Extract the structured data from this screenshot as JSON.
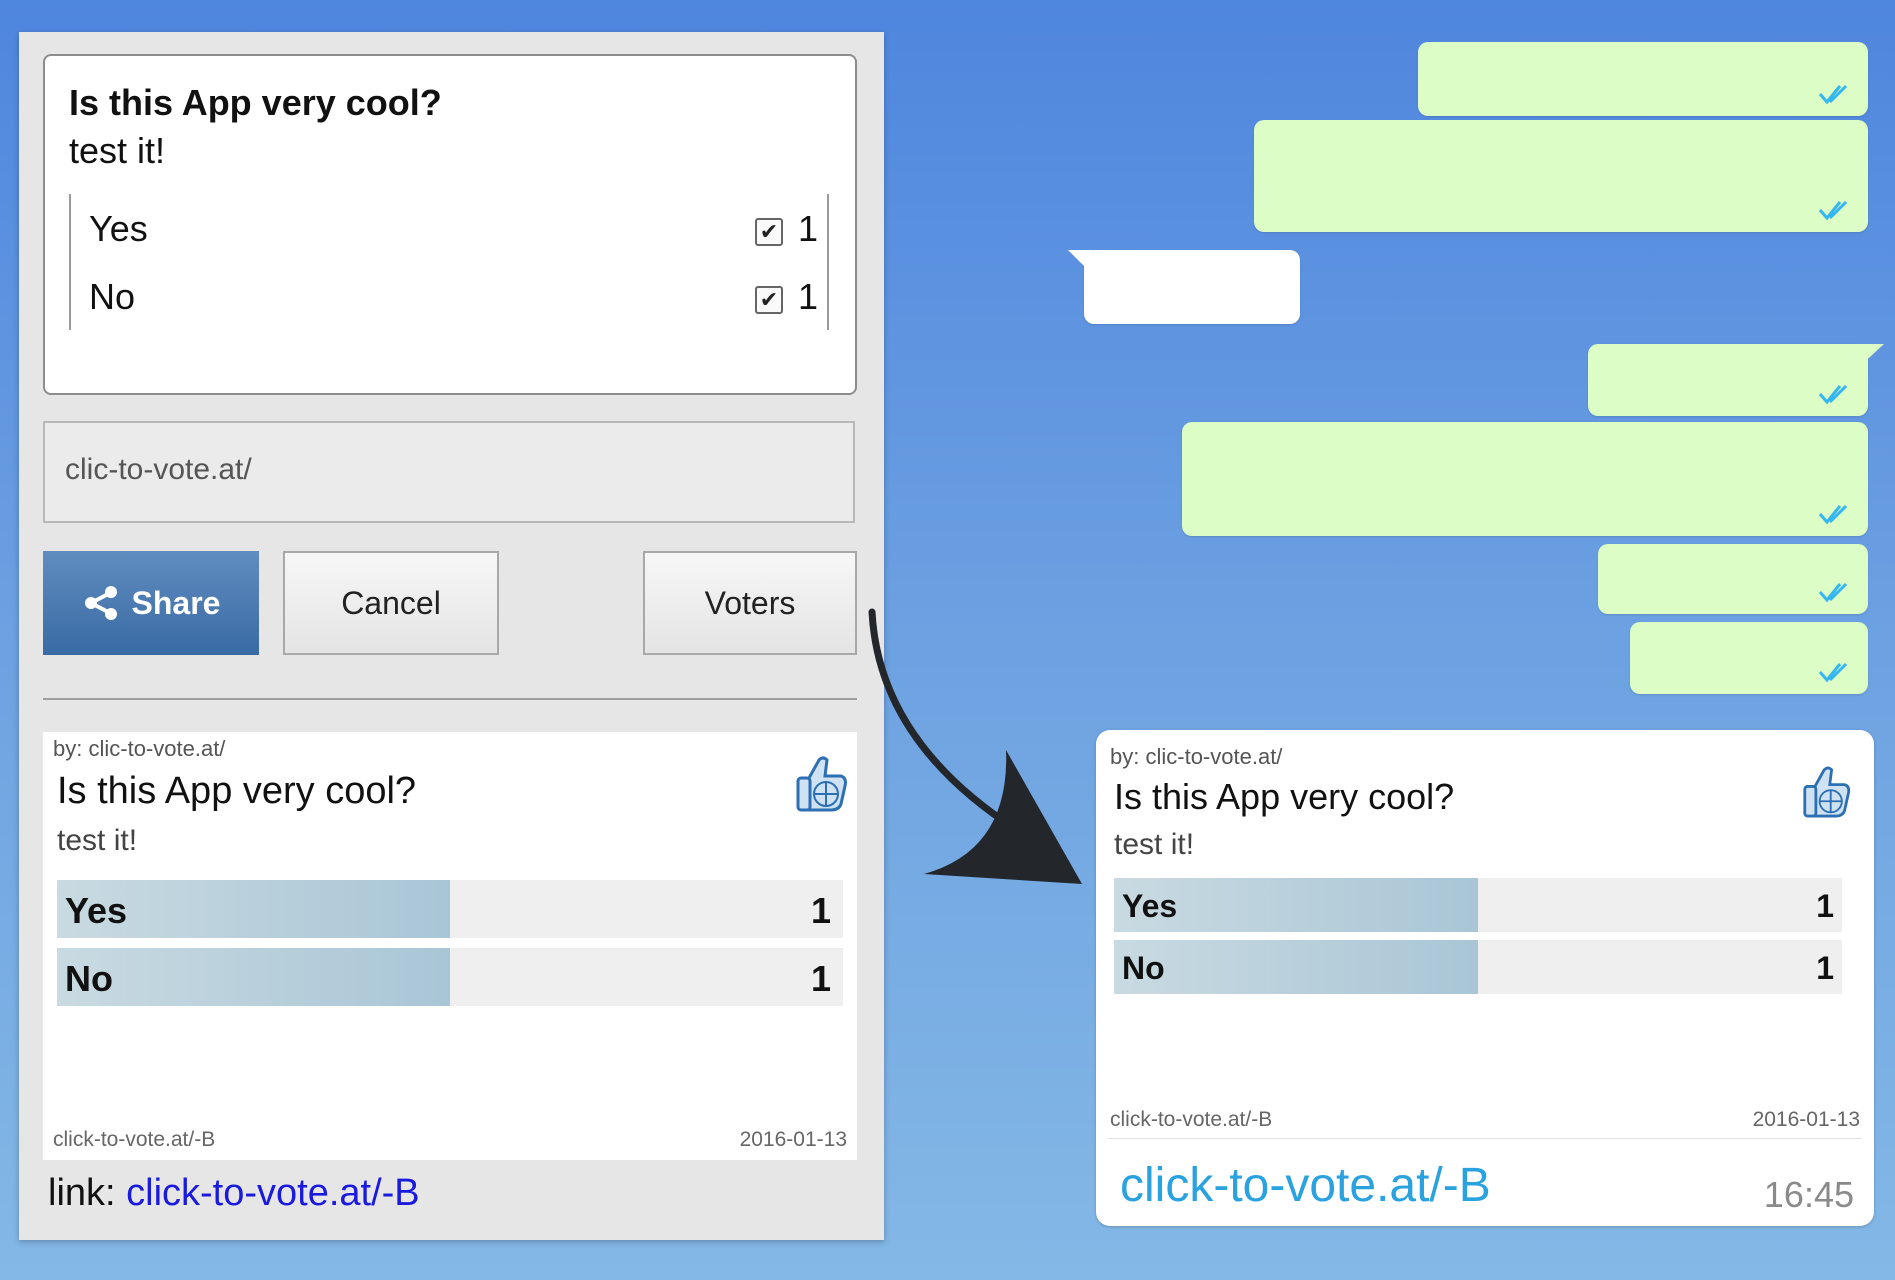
{
  "poll": {
    "title": "Is this App very cool?",
    "subtitle": "test it!",
    "options": [
      {
        "label": "Yes",
        "checked": true,
        "count": "1"
      },
      {
        "label": "No",
        "checked": true,
        "count": "1"
      }
    ]
  },
  "url_field": {
    "value": "clic-to-vote.at/"
  },
  "buttons": {
    "share": "Share",
    "cancel": "Cancel",
    "voters": "Voters"
  },
  "result_card": {
    "by_prefix": "by:",
    "by_value": "clic-to-vote.at/",
    "title": "Is this App very cool?",
    "subtitle": "test it!",
    "bars": [
      {
        "label": "Yes",
        "count": "1",
        "fraction": 0.5
      },
      {
        "label": "No",
        "count": "1",
        "fraction": 0.5
      }
    ],
    "footer_url": "click-to-vote.at/-B",
    "footer_date": "2016-01-13"
  },
  "link": {
    "prefix": "link:",
    "url": "click-to-vote.at/-B"
  },
  "chat": {
    "shared_link": "click-to-vote.at/-B",
    "time": "16:45"
  },
  "colors": {
    "share_button": "#3a6aa4",
    "outgoing_bubble": "#dcfdc6",
    "link_blue": "#1a1adf",
    "chat_link": "#2aa2e0",
    "tick_blue": "#34b7f1"
  }
}
